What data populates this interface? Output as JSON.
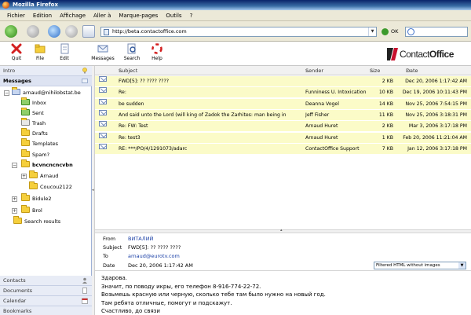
{
  "window": {
    "title": "Mozilla Firefox"
  },
  "menu": [
    "Fichier",
    "Edition",
    "Affichage",
    "Aller à",
    "Marque-pages",
    "Outils",
    "?"
  ],
  "nav": {
    "url": "http://beta.contactoffice.com",
    "go_label": "OK"
  },
  "toolbar": {
    "quit": "Quit",
    "file": "File",
    "edit": "Edit",
    "messages": "Messages",
    "search": "Search",
    "help": "Help"
  },
  "brand": {
    "logo_prefix": "Contact",
    "logo_suffix": "Office",
    "color": "#c8102e"
  },
  "sidebar": {
    "intro": "Intro",
    "messages": "Messages",
    "contacts": "Contacts",
    "documents": "Documents",
    "calendar": "Calendar",
    "bookmarks": "Bookmarks",
    "tree": [
      "arnaud@nihilobstat.be",
      "Inbox",
      "Sent",
      "Trash",
      "Drafts",
      "Templates",
      "Spam?",
      "bcvncncncvbn",
      "Arnaud",
      "Coucou2122",
      "Bidule2",
      "Brol",
      "Search results"
    ]
  },
  "list": {
    "headers": {
      "subject": "Subject",
      "sender": "Sender",
      "size": "Size",
      "date": "Date"
    },
    "rows": [
      {
        "subject": "FWD[5]: ?? ???? ????",
        "sender": "",
        "size": "2 KB",
        "date": "Dec 20, 2006 1:17:42 AM"
      },
      {
        "subject": "Re:",
        "sender": "Funniness U. Intoxication",
        "size": "10 KB",
        "date": "Dec 19, 2006 10:11:43 PM"
      },
      {
        "subject": "be sudden",
        "sender": "Deanna Vogel",
        "size": "14 KB",
        "date": "Nov 25, 2006 7:54:15 PM"
      },
      {
        "subject": "And said unto the Lord (will king of Zadok the Zarhites: man being in",
        "sender": "Jeff Fisher",
        "size": "11 KB",
        "date": "Nov 25, 2006 3:18:31 PM"
      },
      {
        "subject": "Re: FW: Test",
        "sender": "Arnaud Huret",
        "size": "2 KB",
        "date": "Mar 3, 2006 3:17:18 PM"
      },
      {
        "subject": "Re: test3",
        "sender": "Arnaud Huret",
        "size": "1 KB",
        "date": "Feb 20, 2006 11:21:04 AM"
      },
      {
        "subject": "RE: ***/PO/4/1291073/adarc",
        "sender": "ContactOffice Support",
        "size": "7 KB",
        "date": "Jan 12, 2006 3:17:18 PM"
      }
    ]
  },
  "message": {
    "from_label": "From",
    "from": "ВИТАЛИЙ",
    "subject_label": "Subject",
    "subject": "FWD[5]: ?? ???? ????",
    "to_label": "To",
    "to": "arnaud@eurotv.com",
    "date_label": "Date",
    "date": "Dec 20, 2006 1:17:42 AM",
    "filter": "Filtered HTML without images",
    "body": [
      "Здарова.",
      "Значит, по поводу икры, его телефон 8-916-774-22-72.",
      "Возьмешь красную или черную, сколько тебе там было нужно на новый год.",
      "Там ребята отличные, помогут и подскажут.",
      "Счастливо, до связи"
    ]
  }
}
